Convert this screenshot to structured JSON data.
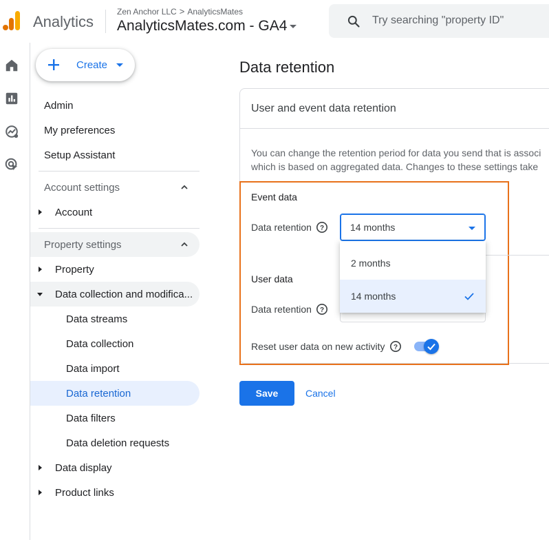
{
  "header": {
    "app_name": "Analytics",
    "breadcrumb_account": "Zen Anchor LLC",
    "breadcrumb_separator": ">",
    "breadcrumb_property": "AnalyticsMates",
    "property_name": "AnalyticsMates.com - GA4",
    "search_placeholder": "Try searching \"property ID\""
  },
  "nav": {
    "create_label": "Create",
    "admin": "Admin",
    "my_preferences": "My preferences",
    "setup_assistant": "Setup Assistant",
    "account_settings": "Account settings",
    "account": "Account",
    "property_settings": "Property settings",
    "property": "Property",
    "data_collection_modification": "Data collection and modifica...",
    "data_streams": "Data streams",
    "data_collection": "Data collection",
    "data_import": "Data import",
    "data_retention": "Data retention",
    "data_filters": "Data filters",
    "data_deletion_requests": "Data deletion requests",
    "data_display": "Data display",
    "product_links": "Product links"
  },
  "main": {
    "page_title": "Data retention",
    "card_title": "User and event data retention",
    "description_line1": "You can change the retention period for data you send that is associ",
    "description_line2": "which is based on aggregated data. Changes to these settings take",
    "event_data_label": "Event data",
    "event_retention_label": "Data retention",
    "event_retention_value": "14 months",
    "user_data_label": "User data",
    "user_retention_label": "Data retention",
    "reset_label": "Reset user data on new activity",
    "reset_enabled": true,
    "dropdown_options": [
      "2 months",
      "14 months"
    ],
    "dropdown_selected": "14 months",
    "save_label": "Save",
    "cancel_label": "Cancel"
  },
  "colors": {
    "accent": "#1a73e8",
    "highlight_box": "#e8711a",
    "active_nav_bg": "#e8f0fe"
  }
}
